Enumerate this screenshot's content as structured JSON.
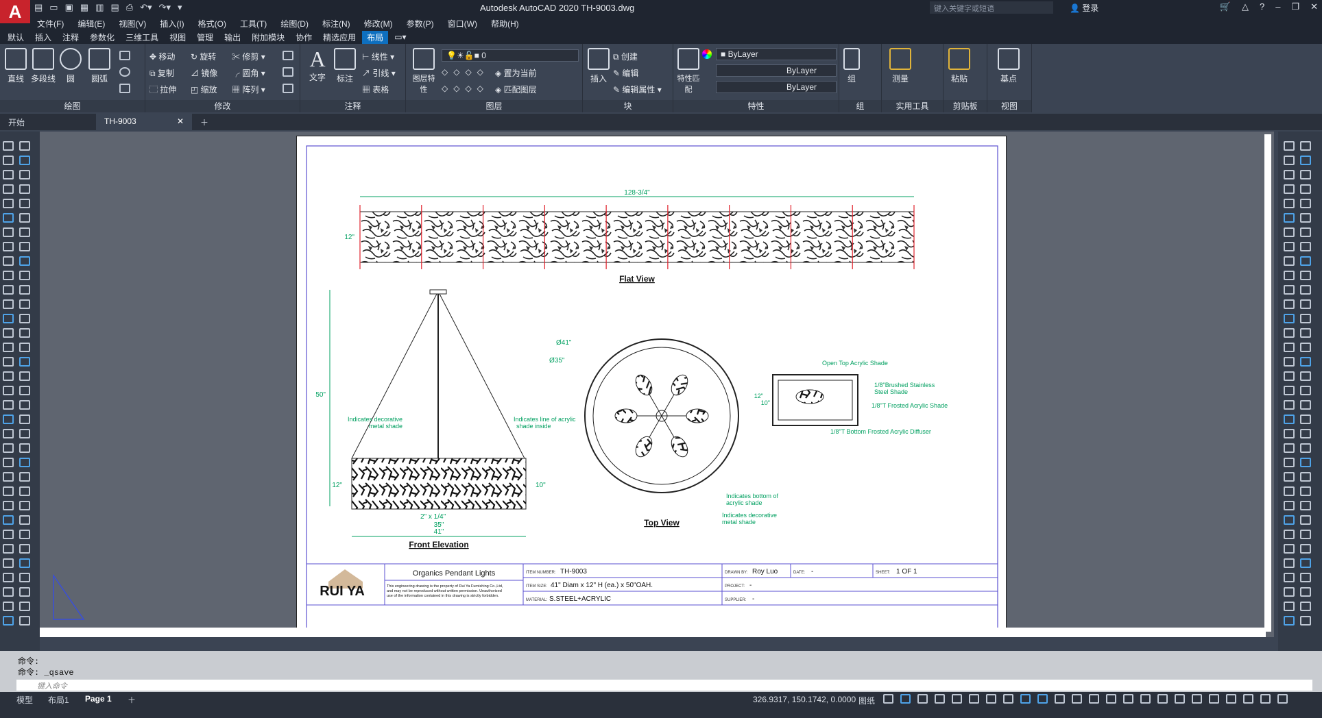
{
  "app": {
    "logo": "A",
    "title": "Autodesk AutoCAD 2020   TH-9003.dwg",
    "search_placeholder": "键入关键字或短语",
    "login": "登录"
  },
  "menu": [
    "文件(F)",
    "编辑(E)",
    "视图(V)",
    "插入(I)",
    "格式(O)",
    "工具(T)",
    "绘图(D)",
    "标注(N)",
    "修改(M)",
    "参数(P)",
    "窗口(W)",
    "帮助(H)"
  ],
  "ribbon_tabs": [
    "默认",
    "插入",
    "注释",
    "参数化",
    "三维工具",
    "视图",
    "管理",
    "输出",
    "附加模块",
    "协作",
    "精选应用",
    "布局"
  ],
  "ribbon_active_tab": "布局",
  "ribbon": {
    "draw": {
      "label": "绘图",
      "tools": [
        "直线",
        "多段线",
        "圆",
        "圆弧"
      ]
    },
    "modify": {
      "label": "修改",
      "tools": [
        "移动",
        "旋转",
        "修剪",
        "复制",
        "镜像",
        "圆角",
        "拉伸",
        "缩放",
        "阵列"
      ]
    },
    "annotation": {
      "label": "注释",
      "tools": [
        "文字",
        "标注",
        "线性",
        "引线",
        "表格"
      ]
    },
    "layers": {
      "label": "图层",
      "tools": [
        "图层特性",
        "置为当前",
        "匹配图层"
      ],
      "current_layer": "0"
    },
    "block": {
      "label": "块",
      "tools": [
        "插入",
        "创建",
        "编辑",
        "编辑属性"
      ]
    },
    "properties": {
      "label": "特性",
      "tool": "特性匹配",
      "color": "ByLayer",
      "linetype": "ByLayer",
      "lineweight": "ByLayer"
    },
    "groups": {
      "label": "组",
      "tool": "组"
    },
    "utilities": {
      "label": "实用工具",
      "tool": "测量"
    },
    "clipboard": {
      "label": "剪贴板",
      "tool": "粘贴"
    },
    "view": {
      "label": "视图",
      "tool": "基点"
    }
  },
  "doc_tabs": [
    "开始",
    "TH-9003"
  ],
  "drawing": {
    "dim_total": "128-3/4\"",
    "dim_height": "12\"",
    "flat_view": "Flat View",
    "front_elevation": "Front Elevation",
    "top_view": "Top View",
    "dim_50": "50\"",
    "dim_12": "12\"",
    "dim_10": "10\"",
    "dim_35": "35\"",
    "dim_41": "41\"",
    "dim_2x": "2\" x 1/4\"",
    "diam41": "Ø41\"",
    "diam35": "Ø35\"",
    "note_metal_1": "Indicates decorative",
    "note_metal_2": "metal shade",
    "note_acrylic_1": "Indicates line of acrylic",
    "note_acrylic_2": "shade inside",
    "note_bottom_1": "Indicates bottom of",
    "note_bottom_2": "acrylic shade",
    "note_deco_1": "Indicates decorative",
    "note_deco_2": "metal shade",
    "side_open": "Open Top Acrylic Shade",
    "side_brushed_1": "1/8\"Brushed Stainless",
    "side_brushed_2": "Steel Shade",
    "side_frosted": "1/8\"T Frosted Acrylic Shade",
    "side_diffuser": "1/8\"T Bottom Frosted Acrylic Diffuser",
    "side_12": "12\"",
    "side_10": "10\""
  },
  "title_block": {
    "brand": "RUI YA",
    "product": "Organics Pendant Lights",
    "disclaimer": [
      "This engineering drawing is the property of Rui Ya Furnishing Co.,Ltd,",
      "and may not be reproduced without written permission. Unauthorized",
      "use of the information contained in this drawing is strictly forbidden."
    ],
    "item_number_label": "ITEM NUMBER:",
    "item_number": "TH-9003",
    "item_size_label": "ITEM SIZE:",
    "item_size": "41\" Diam x 12\" H (ea.) x 50\"OAH.",
    "material_label": "MATERIAL:",
    "material": "S.STEEL+ACRYLIC",
    "drawn_by_label": "DRAWN BY:",
    "drawn_by": "Roy Luo",
    "date_label": "DATE:",
    "date": "-",
    "sheet_label": "SHEET:",
    "sheet": "1 OF 1",
    "project_label": "PROJECT:",
    "project": "-",
    "supplier_label": "SUPPLIER:",
    "supplier": "-"
  },
  "command": {
    "line1": "命令:",
    "line2": "命令:  _qsave",
    "placeholder": "键入命令"
  },
  "layout_tabs": [
    "模型",
    "布局1",
    "Page 1"
  ],
  "status": {
    "coords": "326.9317, 150.1742, 0.0000",
    "paper": "图纸"
  }
}
